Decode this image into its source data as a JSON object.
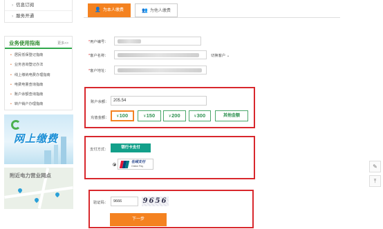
{
  "top_links": [
    {
      "label": "信息订阅"
    },
    {
      "label": "服务开通"
    }
  ],
  "guide": {
    "title": "业务使用指南",
    "more": "更多>>",
    "items": [
      {
        "label": "居民低保登记指南"
      },
      {
        "label": "业务咨询登记办法"
      },
      {
        "label": "线上缴纳电费办理指南"
      },
      {
        "label": "电费电量查询指南"
      },
      {
        "label": "账户余额查询指南"
      },
      {
        "label": "转户销户办理指南"
      }
    ]
  },
  "banner": {
    "text": "网上缴费"
  },
  "map_card": {
    "caption": "附近电力营业网点"
  },
  "tabs": {
    "self_label": "为本人缴费",
    "other_label": "为他人缴费"
  },
  "user": {
    "number_label": "用户编号：",
    "name_label": "客户名称：",
    "address_label": "客户地址：",
    "switch_label": "切换客户"
  },
  "balance": {
    "label": "账户余额：",
    "value": "205.54"
  },
  "recharge": {
    "label": "充值金额：",
    "currency": "¥",
    "amounts": [
      "100",
      "150",
      "200",
      "300"
    ],
    "selected": "100",
    "custom_label": "其他金额"
  },
  "payment": {
    "label": "支付方式：",
    "bank_button": "银行卡支付",
    "unionpay_cn": "在线支付",
    "unionpay_en": "Online Pay",
    "unionpay_mark": "UnionPay"
  },
  "verify": {
    "label": "验证码：",
    "input_value": "9666",
    "captcha_text": "9656",
    "next_button": "下一步"
  },
  "side_tools": [
    {
      "icon": "pencil-icon",
      "glyph": "✎"
    },
    {
      "icon": "back-to-top-icon",
      "glyph": "⤒"
    }
  ],
  "colors": {
    "accent": "#f48220",
    "green": "#2fa74a",
    "teal": "#13a08a",
    "highlight": "#d8272c"
  }
}
